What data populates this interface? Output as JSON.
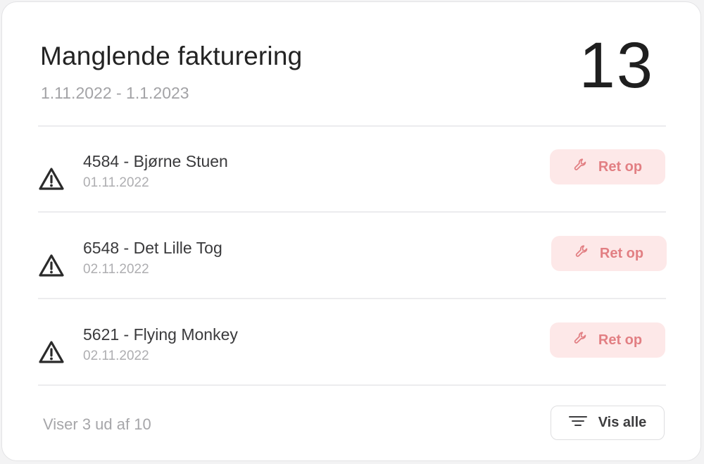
{
  "card": {
    "title": "Manglende fakturering",
    "period": "1.11.2022 - 1.1.2023",
    "count": "13"
  },
  "items": [
    {
      "name": "4584 - Bjørne Stuen",
      "date": "01.11.2022",
      "action_label": "Ret op"
    },
    {
      "name": "6548 - Det Lille Tog",
      "date": "02.11.2022",
      "action_label": "Ret op"
    },
    {
      "name": "5621 - Flying Monkey",
      "date": "02.11.2022",
      "action_label": "Ret op"
    }
  ],
  "footer": {
    "showing_text": "Viser 3 ud af 10",
    "show_all_label": "Vis alle"
  },
  "icons": {
    "row_status": "warning-triangle-icon",
    "fix_button": "wrench-icon",
    "show_all": "filter-lines-icon"
  },
  "colors": {
    "fix_button_bg": "#fde8e8",
    "fix_button_text": "#e27f83",
    "muted_text": "#a6a6a9"
  }
}
